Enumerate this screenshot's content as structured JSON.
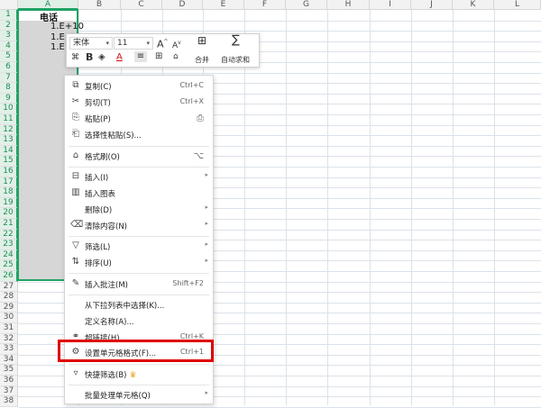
{
  "columns": [
    "A",
    "B",
    "C",
    "D",
    "E",
    "F",
    "G",
    "H",
    "I",
    "J",
    "K",
    "L"
  ],
  "rows": [
    "1",
    "2",
    "3",
    "4",
    "5",
    "6",
    "7",
    "8",
    "9",
    "10",
    "11",
    "12",
    "13",
    "14",
    "15",
    "16",
    "17",
    "18",
    "19",
    "20",
    "21",
    "22",
    "23",
    "24",
    "25",
    "26",
    "27",
    "28",
    "29",
    "30",
    "31",
    "32",
    "33",
    "34",
    "35",
    "36",
    "37",
    "38"
  ],
  "cells": {
    "a1": "电话",
    "a2": "1.E+10",
    "a3": "1.E+",
    "a4": "1.E+"
  },
  "mini_toolbar": {
    "font_name": "宋体",
    "font_size": "11",
    "grow_font": "A",
    "shrink_font": "A",
    "merge_label": "合并",
    "autosum_label": "自动求和",
    "bold": "B",
    "font_color": "A"
  },
  "menu": {
    "copy": {
      "label": "复制(C)",
      "shortcut": "Ctrl+C"
    },
    "cut": {
      "label": "剪切(T)",
      "shortcut": "Ctrl+X"
    },
    "paste": {
      "label": "粘贴(P)"
    },
    "paste_special": {
      "label": "选择性粘贴(S)..."
    },
    "format_painter": {
      "label": "格式刷(O)"
    },
    "insert": {
      "label": "插入(I)"
    },
    "insert_chart": {
      "label": "插入图表"
    },
    "delete": {
      "label": "删除(D)"
    },
    "clear": {
      "label": "清除内容(N)"
    },
    "filter": {
      "label": "筛选(L)"
    },
    "sort": {
      "label": "排序(U)"
    },
    "insert_comment": {
      "label": "插入批注(M)",
      "shortcut": "Shift+F2"
    },
    "pick_from_list": {
      "label": "从下拉列表中选择(K)..."
    },
    "define_name": {
      "label": "定义名称(A)..."
    },
    "hyperlink": {
      "label": "超链接(H)...",
      "shortcut": "Ctrl+K"
    },
    "format_cells": {
      "label": "设置单元格格式(F)...",
      "shortcut": "Ctrl+1"
    },
    "quick_filter": {
      "label": "快捷筛选(B)"
    },
    "batch_process": {
      "label": "批量处理单元格(Q)"
    }
  },
  "colors": {
    "selection_green": "#21a366",
    "highlight_red": "#e00000",
    "crown": "#f0a020"
  },
  "icons": [
    "copy-icon",
    "cut-icon",
    "paste-icon",
    "paste-special-icon",
    "format-painter-icon",
    "insert-icon",
    "chart-icon",
    "delete-icon",
    "clear-icon",
    "filter-icon",
    "sort-icon",
    "comment-icon",
    "format-cells-icon",
    "quick-filter-icon",
    "crown-icon"
  ]
}
